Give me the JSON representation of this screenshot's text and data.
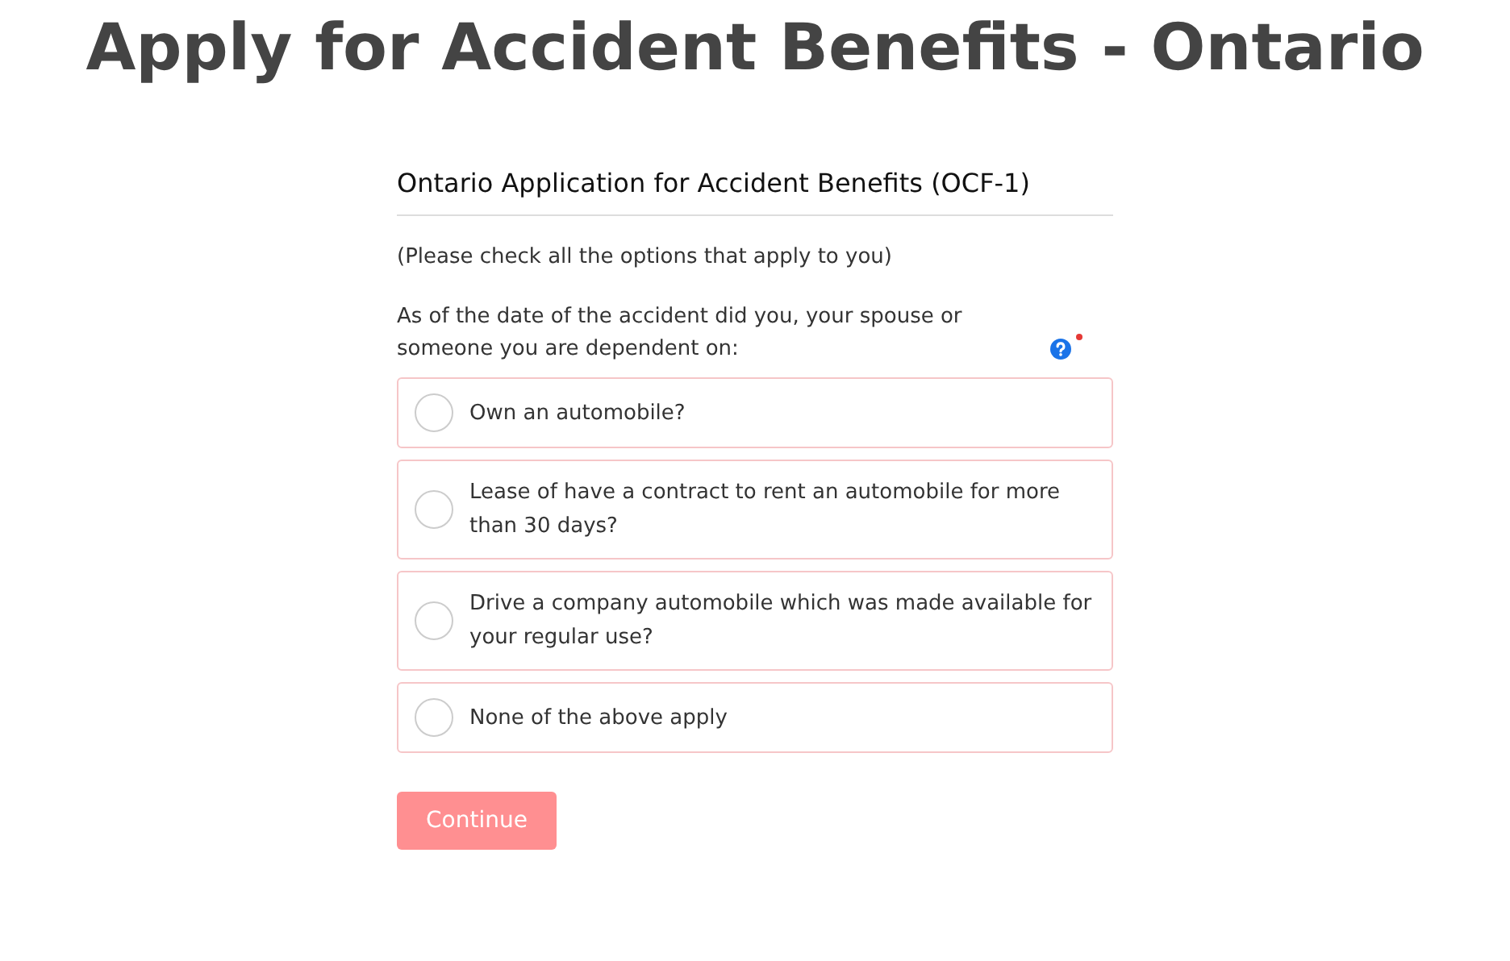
{
  "page_title": "Apply for Accident Benefits - Ontario",
  "form": {
    "title": "Ontario Application for Accident Benefits (OCF-1)",
    "instruction": "(Please check all the options that apply to you)",
    "question": "As of the date of the accident did you, your spouse or someone you are dependent on:",
    "required": true,
    "options": [
      {
        "label": "Own an automobile?",
        "checked": false
      },
      {
        "label": "Lease of have a contract to rent an automobile for more than 30 days?",
        "checked": false
      },
      {
        "label": "Drive a company automobile which was made available for your regular use?",
        "checked": false
      },
      {
        "label": "None of the above apply",
        "checked": false
      }
    ],
    "button": {
      "label": "Continue",
      "disabled": true
    }
  }
}
